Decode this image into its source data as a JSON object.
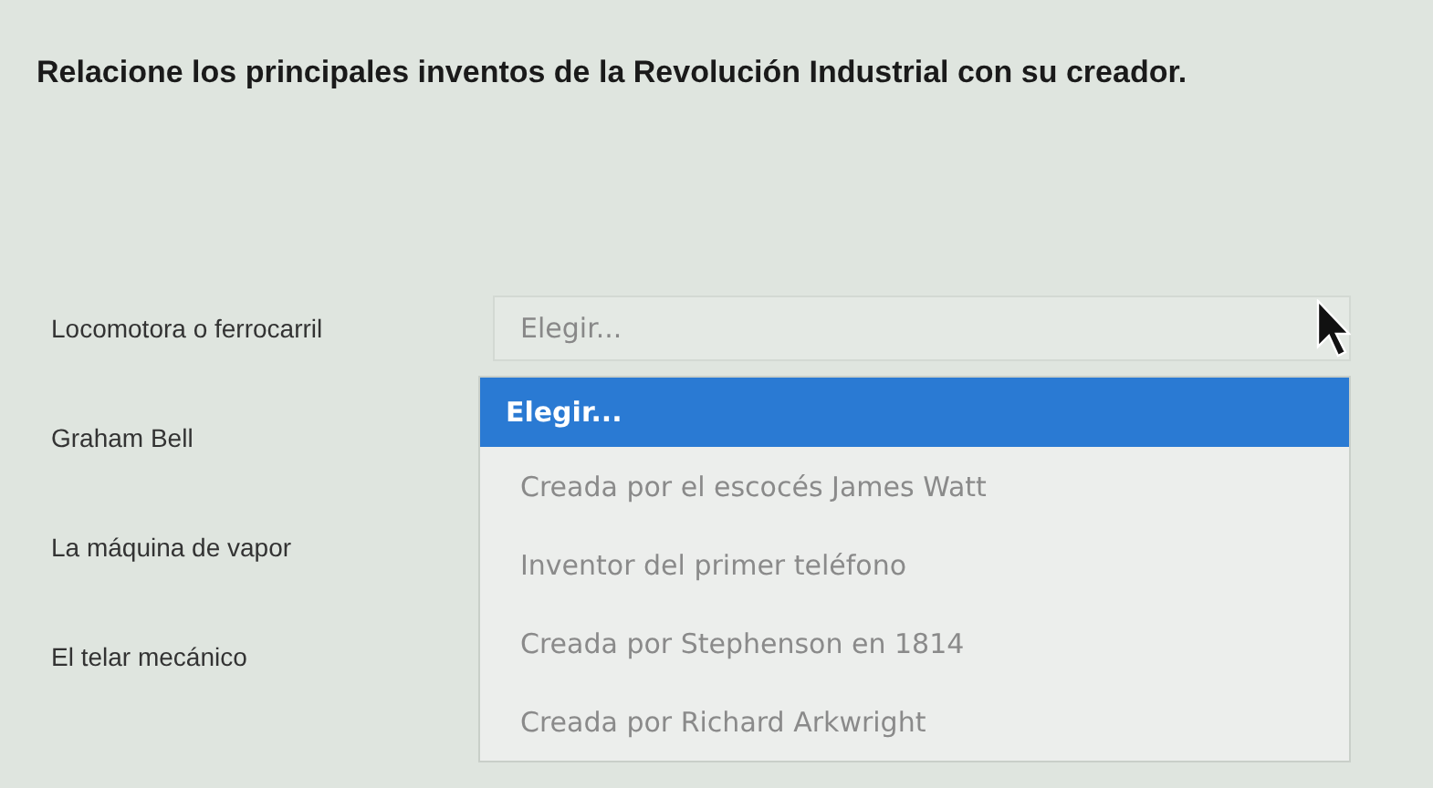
{
  "question": "Relacione los principales inventos de la Revolución Industrial con su creador.",
  "rows": [
    {
      "label": "Locomotora o ferrocarril"
    },
    {
      "label": "Graham Bell"
    },
    {
      "label": "La máquina de vapor"
    },
    {
      "label": "El telar mecánico"
    }
  ],
  "select": {
    "value": "Elegir...",
    "expanded": true
  },
  "options": [
    {
      "label": "Elegir...",
      "selected": true
    },
    {
      "label": "Creada por el escocés James Watt",
      "selected": false
    },
    {
      "label": "Inventor del primer teléfono",
      "selected": false
    },
    {
      "label": "Creada por Stephenson en 1814",
      "selected": false
    },
    {
      "label": "Creada por Richard Arkwright",
      "selected": false
    }
  ]
}
